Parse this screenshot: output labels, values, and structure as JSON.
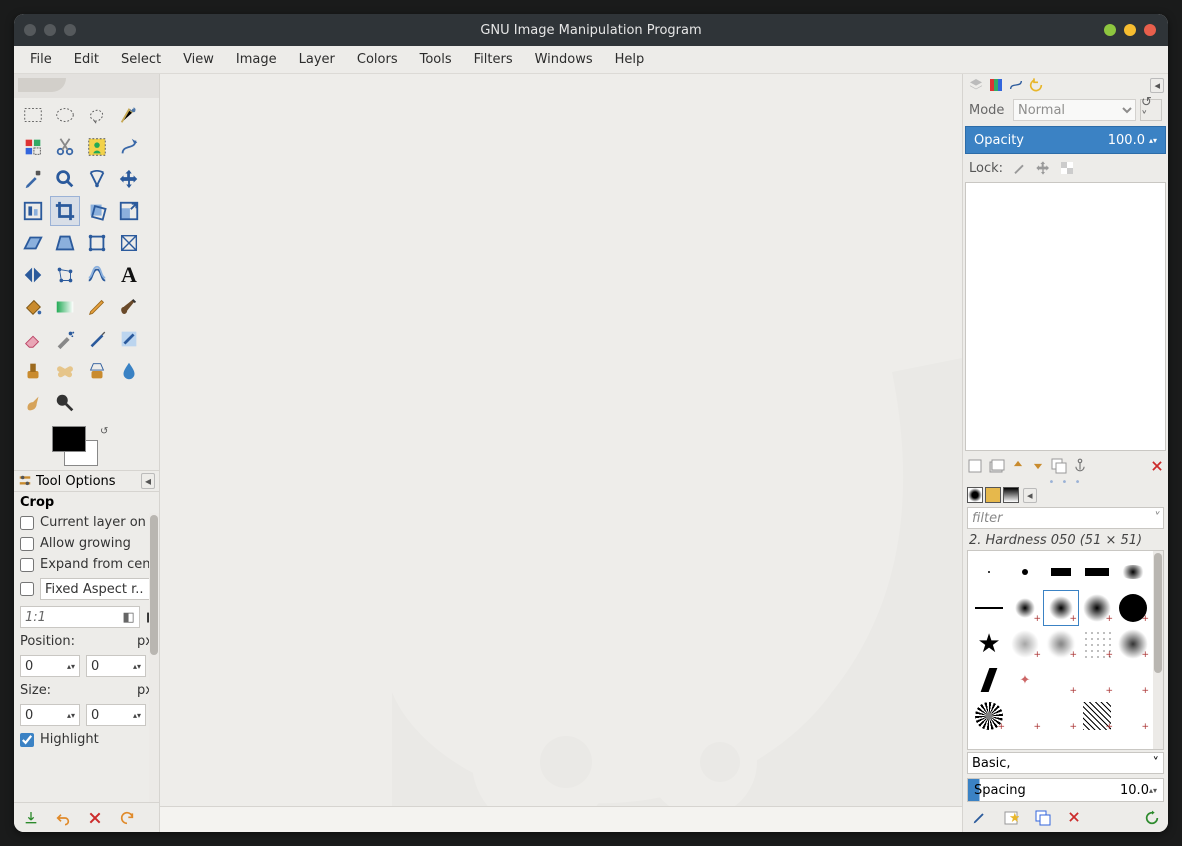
{
  "window": {
    "title": "GNU Image Manipulation Program"
  },
  "menu": [
    "File",
    "Edit",
    "Select",
    "View",
    "Image",
    "Layer",
    "Colors",
    "Tools",
    "Filters",
    "Windows",
    "Help"
  ],
  "toolbox": {
    "tools": [
      "rect-select",
      "ellipse-select",
      "free-select",
      "fuzzy-select",
      "by-color-select",
      "scissors",
      "foreground-select",
      "paths",
      "color-picker",
      "zoom",
      "measure",
      "move",
      "align",
      "crop",
      "rotate",
      "scale",
      "shear",
      "perspective",
      "unified-transform",
      "cage",
      "flip",
      "handle-transform",
      "warp",
      "text",
      "bucket-fill",
      "blend",
      "pencil",
      "paintbrush",
      "eraser",
      "airbrush",
      "ink",
      "mypaint",
      "clone",
      "heal",
      "perspective-clone",
      "blur-sharpen",
      "smudge",
      "dodge-burn"
    ],
    "selected": "crop"
  },
  "tool_options": {
    "tab_label": "Tool Options",
    "title": "Crop",
    "current_layer_only": "Current layer on",
    "allow_growing": "Allow growing",
    "expand_from_center": "Expand from cen",
    "fixed_label": "Fixed Aspect r..",
    "aspect_value": "1:1",
    "position_label": "Position:",
    "position_unit": "px",
    "position_x": "0",
    "position_y": "0",
    "size_label": "Size:",
    "size_unit": "px",
    "size_w": "0",
    "size_h": "0",
    "highlight_label": "Highlight",
    "highlight_checked": true
  },
  "right": {
    "mode_label": "Mode",
    "mode_value": "Normal",
    "opacity_label": "Opacity",
    "opacity_value": "100.0",
    "lock_label": "Lock:",
    "brush_filter_placeholder": "filter",
    "brush_title": "2. Hardness 050 (51 × 51)",
    "brush_preset": "Basic,",
    "spacing_label": "Spacing",
    "spacing_value": "10.0"
  }
}
